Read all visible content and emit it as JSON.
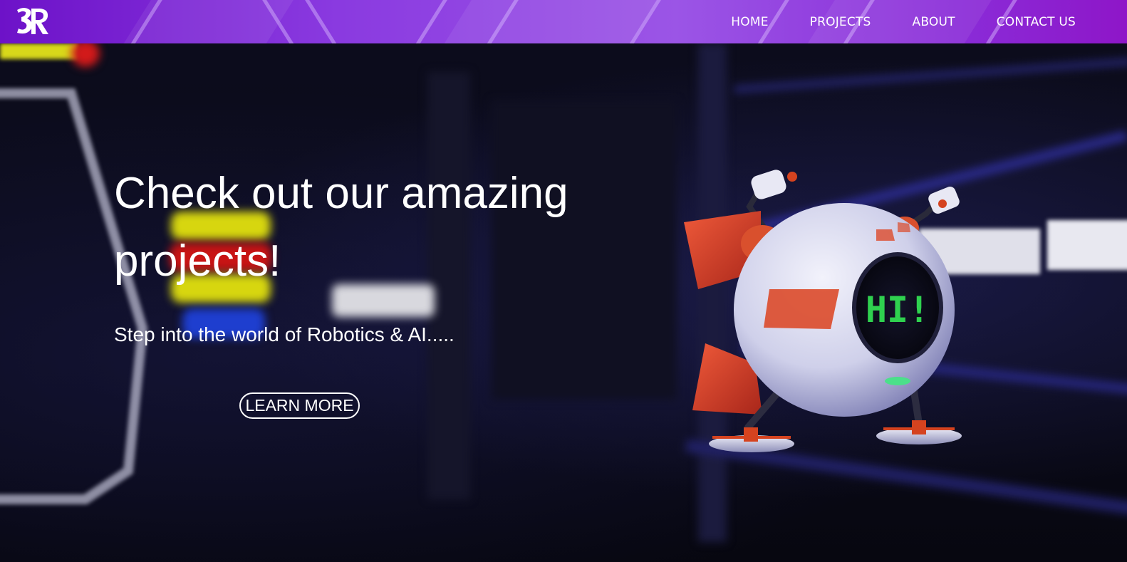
{
  "brand": {
    "logo_text": "3R"
  },
  "nav": {
    "items": [
      {
        "label": "HOME"
      },
      {
        "label": "PROJECTS"
      },
      {
        "label": "ABOUT"
      },
      {
        "label": "CONTACT US"
      }
    ]
  },
  "hero": {
    "title_main": "Check out our amazing projects",
    "title_punct": "!",
    "subtitle": "Step into the world of Robotics & AI.....",
    "cta_label": "LEARN MORE",
    "robot_screen_text": "HI!"
  },
  "colors": {
    "nav_gradient_start": "#6d12c8",
    "nav_gradient_end": "#8e16c8",
    "hero_text": "#ffffff",
    "robot_screen_text": "#2fd14f",
    "robot_accent": "#e0452a"
  },
  "icons": {
    "logo": "brand-logo"
  }
}
